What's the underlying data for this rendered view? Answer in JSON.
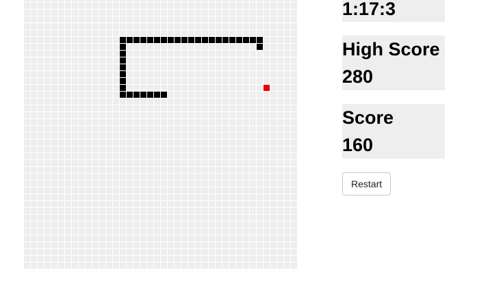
{
  "game": {
    "board": {
      "cols": 40,
      "rows": 40,
      "snake": [
        [
          14,
          6
        ],
        [
          15,
          6
        ],
        [
          16,
          6
        ],
        [
          17,
          6
        ],
        [
          18,
          6
        ],
        [
          19,
          6
        ],
        [
          20,
          6
        ],
        [
          21,
          6
        ],
        [
          22,
          6
        ],
        [
          23,
          6
        ],
        [
          24,
          6
        ],
        [
          25,
          6
        ],
        [
          26,
          6
        ],
        [
          27,
          6
        ],
        [
          28,
          6
        ],
        [
          29,
          6
        ],
        [
          30,
          6
        ],
        [
          31,
          6
        ],
        [
          32,
          6
        ],
        [
          33,
          6
        ],
        [
          34,
          6
        ],
        [
          34,
          7
        ],
        [
          14,
          7
        ],
        [
          14,
          8
        ],
        [
          14,
          9
        ],
        [
          14,
          10
        ],
        [
          14,
          11
        ],
        [
          14,
          12
        ],
        [
          14,
          13
        ],
        [
          14,
          14
        ],
        [
          15,
          14
        ],
        [
          16,
          14
        ],
        [
          17,
          14
        ],
        [
          18,
          14
        ],
        [
          19,
          14
        ],
        [
          20,
          14
        ]
      ],
      "food": [
        35,
        13
      ]
    },
    "colors": {
      "cell": "#eeeeee",
      "snake": "#000000",
      "food": "#e60000",
      "panel": "#eeeeee"
    }
  },
  "stats": {
    "time": "1:17:3",
    "high_score_label": "High Score",
    "high_score_value": "280",
    "score_label": "Score",
    "score_value": "160"
  },
  "controls": {
    "restart_label": "Restart"
  }
}
